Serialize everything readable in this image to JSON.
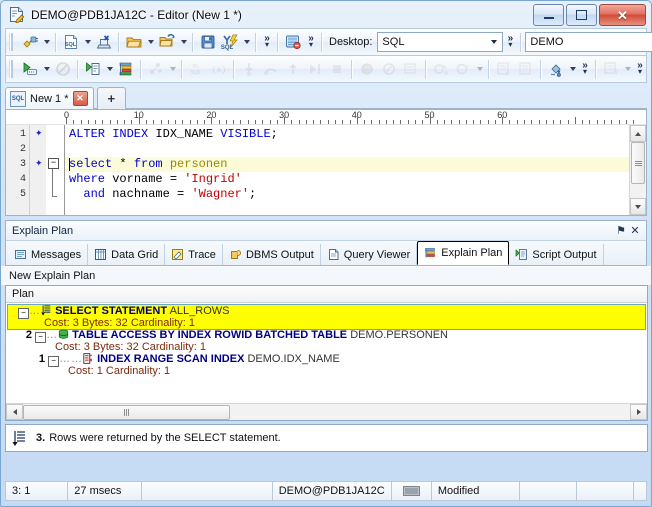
{
  "window": {
    "title": "DEMO@PDB1JA12C - Editor (New 1 *)",
    "icon": "editor-document-pencil-icon",
    "minimize_label": "–",
    "maximize_label": "□",
    "close_label": "✕"
  },
  "toolbar": {
    "desktop_label": "Desktop:",
    "desktop_value": "SQL",
    "connection_value": "DEMO",
    "row1_icons": [
      "new-connection-icon",
      "new-sql-window-icon",
      "close-window-icon",
      "open-file-icon",
      "open-folder-list-icon",
      "save-icon",
      "execute-sql-icon",
      "overflow-icon",
      "session-browser-icon"
    ],
    "row2_icons": [
      "execute-statement-icon",
      "stop-icon",
      "run-script-icon",
      "explain-plan-icon",
      "pl-sql-beautifier-icon",
      "pl-sql-icon",
      "variables-icon",
      "step-into-icon",
      "step-over-icon",
      "step-out-icon",
      "run-to-icon",
      "debug-stop-icon",
      "breakpoint-icon",
      "breakpoint-off-icon",
      "compile-icon",
      "compile-debug-icon",
      "test-script-icon",
      "save-script-icon",
      "format-color-icon",
      "overflow-icon",
      "report-icon"
    ]
  },
  "editor": {
    "tab_label": "New 1 *",
    "tab_icon": "sql-file-icon",
    "tab_close_label": "✕",
    "add_tab_label": "+",
    "ruler_numbers": [
      "0",
      "10",
      "20",
      "30",
      "40",
      "50",
      "60"
    ],
    "gutter_numbers": [
      "1",
      "2",
      "3",
      "4",
      "5"
    ],
    "fold_marker": "−",
    "lines": [
      {
        "n": 1,
        "highlight": false,
        "tokens": [
          {
            "t": "ALTER INDEX ",
            "c": "kw"
          },
          {
            "t": "IDX_NAME ",
            "c": "pln"
          },
          {
            "t": "VISIBLE",
            "c": "kw"
          },
          {
            "t": ";",
            "c": "pln"
          }
        ]
      },
      {
        "n": 2,
        "highlight": false,
        "tokens": []
      },
      {
        "n": 3,
        "highlight": true,
        "tokens": [
          {
            "t": "select ",
            "c": "kw"
          },
          {
            "t": "* ",
            "c": "pln"
          },
          {
            "t": "from ",
            "c": "kw"
          },
          {
            "t": "personen",
            "c": "tbl"
          }
        ]
      },
      {
        "n": 4,
        "highlight": false,
        "tokens": [
          {
            "t": "where ",
            "c": "kw"
          },
          {
            "t": "vorname = ",
            "c": "pln"
          },
          {
            "t": "'Ingrid'",
            "c": "str"
          }
        ]
      },
      {
        "n": 5,
        "highlight": false,
        "tokens": [
          {
            "t": "  and ",
            "c": "kw"
          },
          {
            "t": "nachname = ",
            "c": "pln"
          },
          {
            "t": "'Wagner'",
            "c": "str"
          },
          {
            "t": ";",
            "c": "pln"
          }
        ]
      }
    ]
  },
  "dock": {
    "header_title": "Explain Plan",
    "pin_label": "⚑",
    "close_label": "✕",
    "tabs": [
      {
        "label": "Messages",
        "icon": "messages-icon",
        "active": false
      },
      {
        "label": "Data Grid",
        "icon": "data-grid-icon",
        "active": false
      },
      {
        "label": "Trace",
        "icon": "trace-icon",
        "active": false
      },
      {
        "label": "DBMS Output",
        "icon": "dbms-output-icon",
        "active": false
      },
      {
        "label": "Query Viewer",
        "icon": "query-viewer-icon",
        "active": false
      },
      {
        "label": "Explain Plan",
        "icon": "explain-plan-icon",
        "active": true
      },
      {
        "label": "Script Output",
        "icon": "script-output-icon",
        "active": false
      }
    ],
    "plan_title": "New Explain Plan",
    "column_header": "Plan",
    "plan_rows": [
      {
        "id": "",
        "operation": "SELECT STATEMENT",
        "object": "ALL_ROWS",
        "detail": "Cost: 3  Bytes: 32  Cardinality: 1",
        "icon": "select-statement-icon",
        "selected": true,
        "indent": 0
      },
      {
        "id": "2",
        "operation": "TABLE ACCESS BY INDEX ROWID BATCHED TABLE",
        "object": "DEMO.PERSONEN",
        "detail": "Cost: 3  Bytes: 32  Cardinality: 1",
        "icon": "table-access-icon",
        "selected": false,
        "indent": 1
      },
      {
        "id": "1",
        "operation": "INDEX RANGE SCAN INDEX",
        "object": "DEMO.IDX_NAME",
        "detail": "Cost: 1  Cardinality: 1",
        "icon": "index-range-scan-icon",
        "selected": false,
        "indent": 2
      }
    ]
  },
  "message": {
    "icon": "select-statement-icon",
    "count": "3.",
    "text": "Rows were returned by the SELECT statement."
  },
  "statusbar": {
    "cursor": "3:  1",
    "elapsed": "27 msecs",
    "blank1": "",
    "connection": "DEMO@PDB1JA12C",
    "keyboard_icon": "keyboard-icon",
    "modified": "Modified",
    "blank2": "",
    "blank3": "",
    "blank4": ""
  },
  "colors": {
    "selection_yellow": "#ffff00",
    "highlight_line": "#fbfbd8",
    "keyword_blue": "#0000d0",
    "string_red": "#c00000",
    "table_olive": "#9a8a00",
    "plan_main": "#000080",
    "plan_cost": "#7a2b10",
    "frame_blue": "#7aa6d4"
  }
}
